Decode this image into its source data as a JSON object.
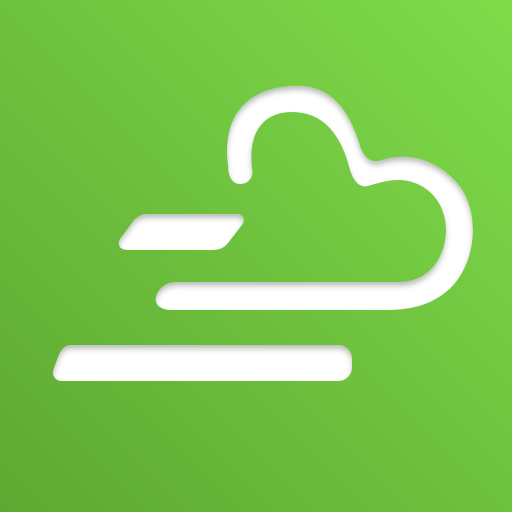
{
  "app_icon": {
    "icon": "windy-cloud-icon",
    "colors": {
      "gradient_top_right": "#80DB4A",
      "gradient_bottom_left": "#5DA832",
      "glyph": "#FFFFFF",
      "glyph_shadow": "#2E5A14"
    }
  }
}
